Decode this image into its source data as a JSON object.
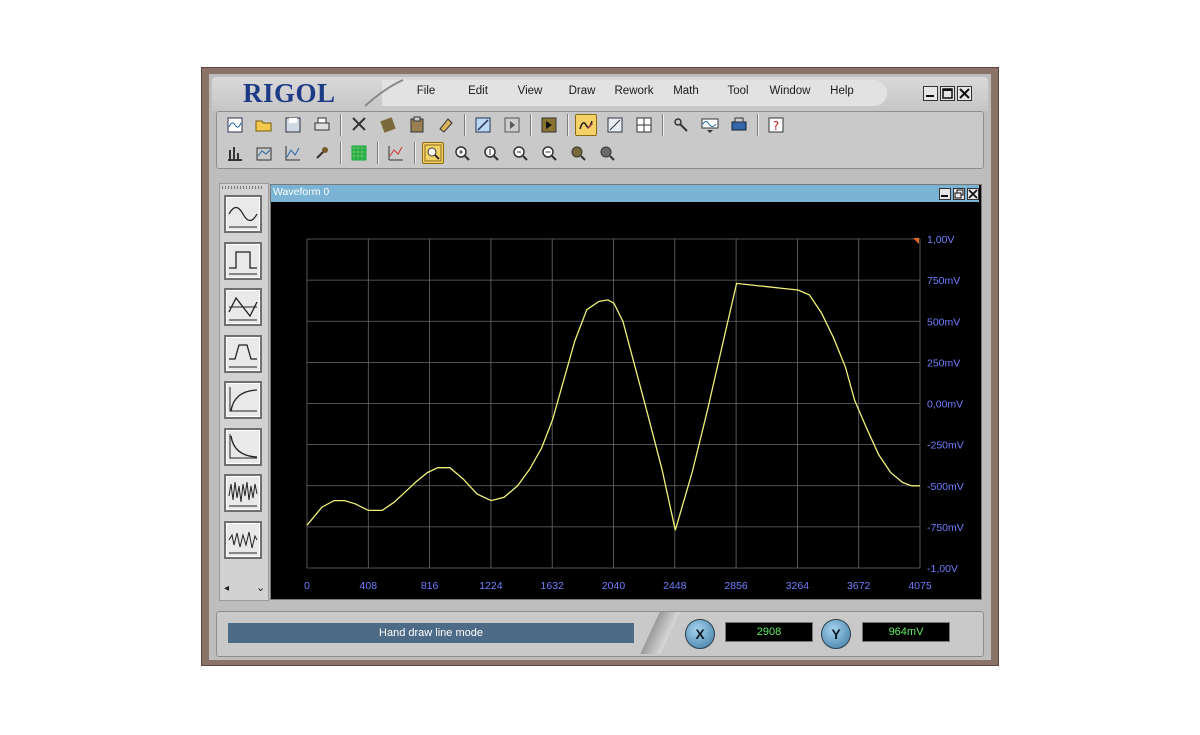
{
  "app": {
    "brand": "RIGOL"
  },
  "menu": [
    "File",
    "Edit",
    "View",
    "Draw",
    "Rework",
    "Math",
    "Tool",
    "Window",
    "Help"
  ],
  "window_buttons": [
    "minimize-icon",
    "maximize-icon",
    "close-icon"
  ],
  "toolbar_row1": [
    "new-waveform-icon",
    "open-folder-icon",
    "save-icon",
    "print-icon",
    "|",
    "cut-icon",
    "copy-icon",
    "paste-icon",
    "eraser-icon",
    "|",
    "line-tool-icon",
    "play-icon",
    "|",
    "marker-icon",
    "|",
    "hand-draw-icon",
    "rectangle-icon",
    "grid-table-icon",
    "|",
    "tool-icon",
    "waveform-store-icon",
    "device-icon",
    "|",
    "help-icon"
  ],
  "toolbar_row2": [
    "bar-chart-icon",
    "area-chart-icon",
    "line-chart-icon",
    "pin-icon",
    "|",
    "grid-view-icon",
    "|",
    "chart-view-icon",
    "|",
    "zoom-fit-icon",
    "zoom-in-icon",
    "zoom-vertical-icon",
    "zoom-out-icon",
    "zoom-reset-icon",
    "pan-icon",
    "zoom-icon"
  ],
  "palette": [
    "sine-wave-icon",
    "square-wave-icon",
    "triangle-wave-icon",
    "pulse-wave-icon",
    "exp-rise-icon",
    "exp-fall-icon",
    "noise-icon",
    "am-wave-icon"
  ],
  "palette_footer": {
    "left": "◂",
    "right": "⌄"
  },
  "waveform": {
    "title": "Waveform 0",
    "title_buttons": [
      "minimize-icon",
      "restore-icon",
      "close-icon"
    ]
  },
  "chart_data": {
    "type": "line",
    "xlim": [
      0,
      4075
    ],
    "ylim": [
      -1.0,
      1.0
    ],
    "x_ticks": [
      "0",
      "408",
      "816",
      "1224",
      "1632",
      "2040",
      "2448",
      "2856",
      "3264",
      "3672",
      "4075"
    ],
    "y_ticks": [
      "1,00V",
      "750mV",
      "500mV",
      "250mV",
      "0,00mV",
      "-250mV",
      "-500mV",
      "-750mV",
      "-1,00V"
    ],
    "grid": true,
    "line_color": "#f0f07a",
    "series": [
      {
        "x": [
          0,
          100,
          180,
          250,
          320,
          408,
          500,
          580,
          650,
          720,
          800,
          870,
          950,
          1040,
          1130,
          1224,
          1310,
          1400,
          1480,
          1560,
          1632,
          1700,
          1780,
          1860,
          1940,
          2000,
          2040,
          2100,
          2170,
          2260,
          2360,
          2448,
          2560,
          2660,
          2760,
          2856,
          2960,
          3060,
          3160,
          3264,
          3340,
          3420,
          3500,
          3580,
          3640,
          3720,
          3800,
          3880,
          3960,
          4020,
          4075
        ],
        "y": [
          -0.74,
          -0.63,
          -0.59,
          -0.59,
          -0.61,
          -0.65,
          -0.65,
          -0.6,
          -0.54,
          -0.48,
          -0.42,
          -0.39,
          -0.39,
          -0.46,
          -0.55,
          -0.59,
          -0.57,
          -0.5,
          -0.4,
          -0.27,
          -0.1,
          0.12,
          0.38,
          0.57,
          0.62,
          0.63,
          0.61,
          0.5,
          0.26,
          -0.05,
          -0.4,
          -0.77,
          -0.42,
          -0.05,
          0.35,
          0.73,
          0.72,
          0.71,
          0.7,
          0.69,
          0.66,
          0.55,
          0.4,
          0.22,
          0.02,
          -0.15,
          -0.31,
          -0.42,
          -0.48,
          -0.5,
          -0.5
        ]
      }
    ]
  },
  "status": {
    "message": "Hand draw line mode"
  },
  "coords": {
    "x_label": "X",
    "x_value": "2908",
    "y_label": "Y",
    "y_value": "964mV"
  }
}
